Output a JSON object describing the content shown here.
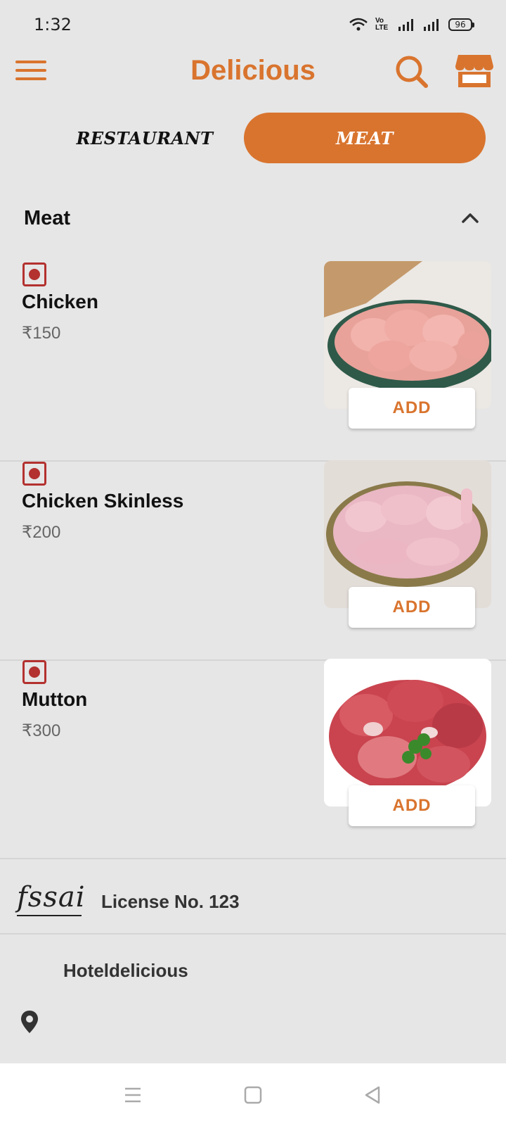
{
  "status": {
    "time": "1:32",
    "battery": "96",
    "network_label": "Vo LTE"
  },
  "header": {
    "title": "Delicious"
  },
  "tabs": [
    {
      "label": "RESTAURANT",
      "active": false
    },
    {
      "label": "MEAT",
      "active": true
    }
  ],
  "section": {
    "title": "Meat"
  },
  "items": [
    {
      "name": "Chicken",
      "price": "₹150",
      "add_label": "ADD"
    },
    {
      "name": "Chicken Skinless",
      "price": "₹200",
      "add_label": "ADD"
    },
    {
      "name": "Mutton",
      "price": "₹300",
      "add_label": "ADD"
    }
  ],
  "license": {
    "logo_text": "fssai",
    "text": "License No. 123"
  },
  "footer": {
    "hotel_name": "Hoteldelicious"
  },
  "colors": {
    "accent": "#d9742e",
    "background": "#e6e6e6",
    "veg_mark": "#b3312f"
  },
  "icons": [
    "menu-icon",
    "search-icon",
    "store-icon",
    "chevron-up-icon",
    "location-pin-icon",
    "wifi-icon",
    "signal-icon",
    "battery-icon"
  ]
}
